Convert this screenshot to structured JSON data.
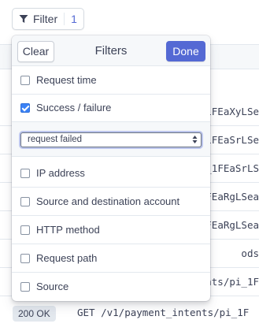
{
  "filter_button": {
    "label": "Filter",
    "count": "1"
  },
  "panel": {
    "clear_label": "Clear",
    "title": "Filters",
    "done_label": "Done",
    "options": [
      {
        "label": "Request time",
        "checked": false
      },
      {
        "label": "Success / failure",
        "checked": true
      },
      {
        "label": "IP address",
        "checked": false
      },
      {
        "label": "Source and destination account",
        "checked": false
      },
      {
        "label": "HTTP method",
        "checked": false
      },
      {
        "label": "Request path",
        "checked": false
      },
      {
        "label": "Source",
        "checked": false
      }
    ],
    "outcome_select": {
      "value": "request failed"
    }
  },
  "background": {
    "row_paths": [
      "_1FEaXyLSe",
      "_1FEaSrLSe",
      "_1FEaSrLS",
      "FEaRgLSea",
      "FEaRgLSea",
      "ods",
      "ents/pi_1F"
    ],
    "last_row": {
      "status": "200 OK",
      "path": "GET /v1/payment_intents/pi_1F"
    }
  },
  "colors": {
    "accent": "#5469d4",
    "checkbox_checked": "#3b82f6"
  }
}
